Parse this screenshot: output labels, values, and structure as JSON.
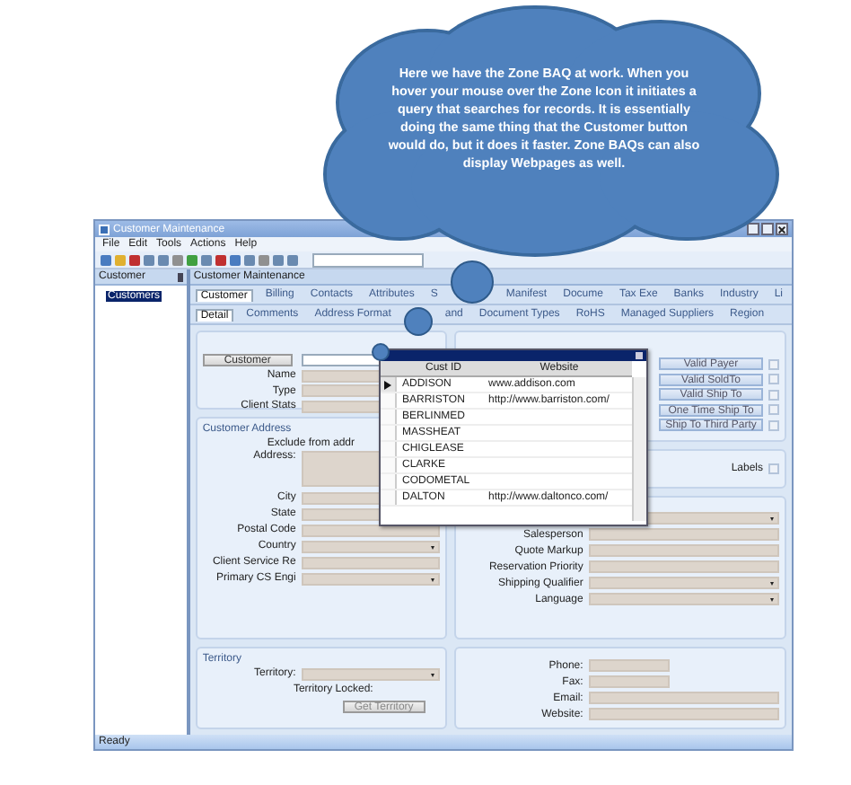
{
  "callout": {
    "text": "Here we have the Zone BAQ at work. When you hover your mouse over the Zone Icon it initiates a query that searches for records.  It is essentially doing the same thing that the Customer button would do, but it does it faster.  Zone BAQs can also display Webpages as well."
  },
  "window": {
    "title": "Customer Maintenance"
  },
  "menu": [
    "File",
    "Edit",
    "Tools",
    "Actions",
    "Help"
  ],
  "left_panel": {
    "title": "Customer",
    "tree": [
      {
        "label": "Customers",
        "selected": true
      }
    ]
  },
  "main_title": "Customer Maintenance",
  "tabs": [
    {
      "label": "Customer",
      "selected": true
    },
    {
      "label": "Billing",
      "selected": false
    },
    {
      "label": "Contacts",
      "selected": false
    },
    {
      "label": "Attributes",
      "selected": false
    },
    {
      "label": "S",
      "selected": false
    },
    {
      "label": "Manifest",
      "selected": false
    },
    {
      "label": "Docume",
      "selected": false
    },
    {
      "label": "Tax Exe",
      "selected": false
    },
    {
      "label": "Banks",
      "selected": false
    },
    {
      "label": "Industry",
      "selected": false
    },
    {
      "label": "Li",
      "selected": false
    }
  ],
  "subtabs": [
    {
      "label": "Detail",
      "selected": true
    },
    {
      "label": "Comments",
      "selected": false
    },
    {
      "label": "Address Format",
      "selected": false
    },
    {
      "label": "and",
      "selected": false
    },
    {
      "label": "Document Types",
      "selected": false
    },
    {
      "label": "RoHS",
      "selected": false
    },
    {
      "label": "Managed Suppliers",
      "selected": false
    },
    {
      "label": "Region",
      "selected": false
    }
  ],
  "customer_group": {
    "button": "Customer",
    "fields": [
      {
        "label": "Name",
        "kind": "text"
      },
      {
        "label": "Type",
        "kind": "text"
      },
      {
        "label": "Client Stats",
        "kind": "text"
      }
    ]
  },
  "address_group": {
    "title": "Customer Address",
    "note": "Exclude from addr",
    "fields": [
      {
        "label": "Address:",
        "kind": "area"
      },
      {
        "label": "City",
        "kind": "text"
      },
      {
        "label": "State",
        "kind": "text"
      },
      {
        "label": "Postal Code",
        "kind": "text"
      },
      {
        "label": "Country",
        "kind": "dropdown"
      },
      {
        "label": "Client Service Re",
        "kind": "text"
      },
      {
        "label": "Primary CS Engi",
        "kind": "dropdown"
      }
    ]
  },
  "validation_buttons": [
    {
      "label": "Valid Payer",
      "checked": false
    },
    {
      "label": "Valid SoldTo",
      "checked": false
    },
    {
      "label": "Valid Ship To",
      "checked": false
    },
    {
      "label": "One Time Ship To",
      "checked": false
    },
    {
      "label": "Ship To Third Party",
      "checked": false
    }
  ],
  "labels_checkbox": {
    "label": "Labels",
    "checked": false
  },
  "sales_group": {
    "fields": [
      {
        "kind": "dropdown"
      },
      {
        "label": "Salesperson",
        "kind": "text"
      },
      {
        "label": "Quote Markup",
        "kind": "text"
      },
      {
        "label": "Reservation Priority",
        "kind": "text"
      },
      {
        "label": "Shipping Qualifier",
        "kind": "dropdown"
      },
      {
        "label": "Language",
        "kind": "dropdown"
      }
    ]
  },
  "territory_group": {
    "title": "Territory",
    "fields": [
      {
        "label": "Territory:",
        "kind": "dropdown"
      }
    ],
    "locked_label": "Territory Locked:",
    "button": "Get Territory"
  },
  "contact_group": {
    "fields": [
      {
        "label": "Phone:",
        "kind": "short"
      },
      {
        "label": "Fax:",
        "kind": "short"
      },
      {
        "label": "Email:",
        "kind": "text"
      },
      {
        "label": "Website:",
        "kind": "text"
      }
    ]
  },
  "zone_popup": {
    "columns": [
      "Cust ID",
      "Website"
    ],
    "rows": [
      {
        "cust_id": "ADDISON",
        "website": "www.addison.com",
        "selected": true
      },
      {
        "cust_id": "BARRISTON",
        "website": "http://www.barriston.com/",
        "selected": false
      },
      {
        "cust_id": "BERLINMED",
        "selected": false
      },
      {
        "cust_id": "MASSHEAT",
        "selected": false
      },
      {
        "cust_id": "CHIGLEASE",
        "selected": false
      },
      {
        "cust_id": "CLARKE",
        "selected": false
      },
      {
        "cust_id": "CODOMETAL",
        "selected": false
      },
      {
        "cust_id": "DALTON",
        "website": "http://www.daltonco.com/",
        "selected": false
      }
    ]
  },
  "status_bar": "Ready"
}
